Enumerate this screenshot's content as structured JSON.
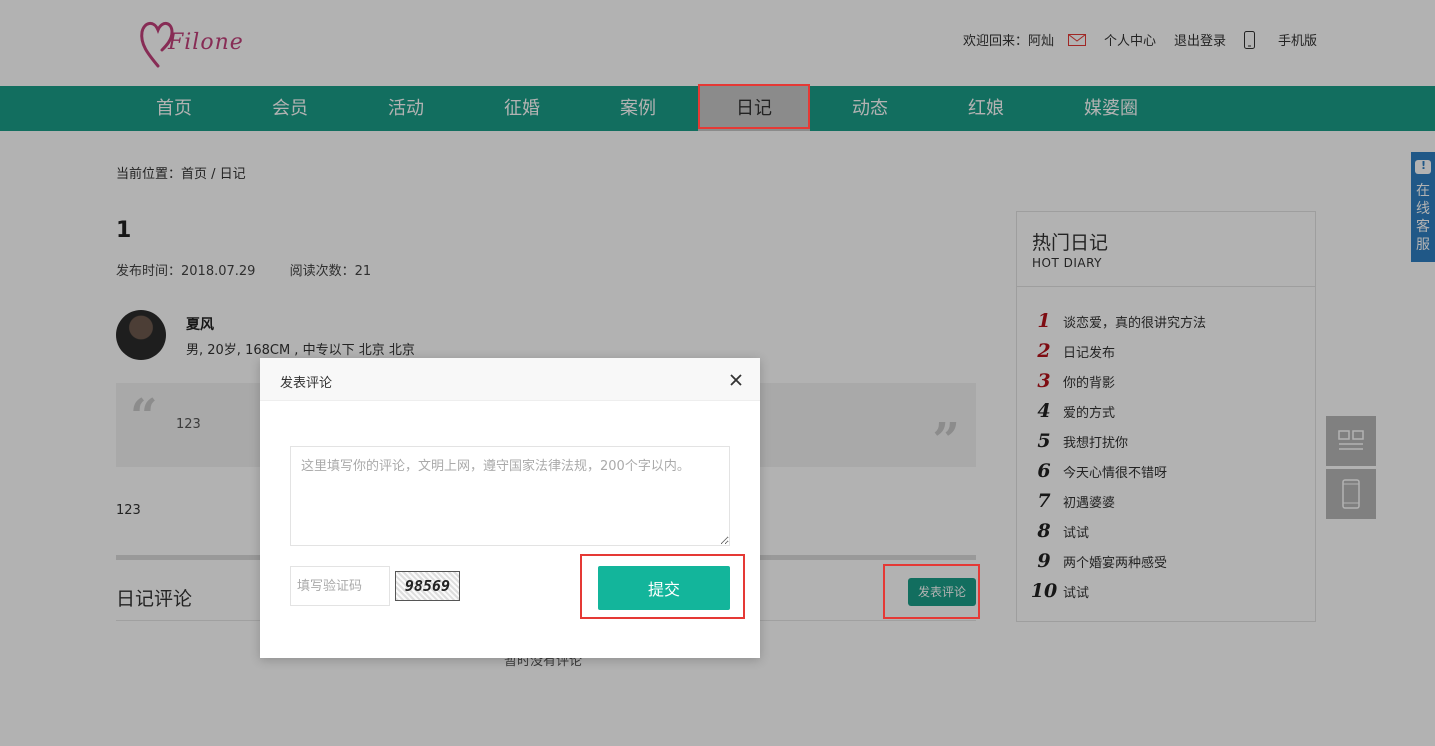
{
  "header": {
    "logo_text": "Filone",
    "welcome": "欢迎回来：阿灿",
    "links": {
      "profile": "个人中心",
      "logout": "退出登录",
      "mobile": "手机版"
    }
  },
  "nav": {
    "items": [
      "首页",
      "会员",
      "活动",
      "征婚",
      "案例",
      "日记",
      "动态",
      "红娘",
      "媒婆圈"
    ],
    "active_index": 5
  },
  "breadcrumb": "当前位置：首页 / 日记",
  "article": {
    "title": "1",
    "publish_time": "发布时间：2018.07.29",
    "read_count": "阅读次数：21",
    "author": {
      "name": "夏风",
      "info": "男, 20岁, 168CM , 中专以下 北京 北京"
    },
    "quote": "123",
    "content": "123"
  },
  "comments": {
    "title": "日记评论",
    "post_button": "发表评论",
    "empty_text": "暂时没有评论"
  },
  "sidebar": {
    "title": "热门日记",
    "subtitle": "HOT DIARY",
    "items": [
      {
        "num": "1",
        "title": "谈恋爱，真的很讲究方法"
      },
      {
        "num": "2",
        "title": "日记发布"
      },
      {
        "num": "3",
        "title": "你的背影"
      },
      {
        "num": "4",
        "title": "爱的方式"
      },
      {
        "num": "5",
        "title": "我想打扰你"
      },
      {
        "num": "6",
        "title": "今天心情很不错呀"
      },
      {
        "num": "7",
        "title": "初遇婆婆"
      },
      {
        "num": "8",
        "title": "试试"
      },
      {
        "num": "9",
        "title": "两个婚宴两种感受"
      },
      {
        "num": "10",
        "title": "试试"
      }
    ]
  },
  "service": {
    "label": "在线客服"
  },
  "modal": {
    "title": "发表评论",
    "textarea_placeholder": "这里填写你的评论，文明上网，遵守国家法律法规，200个字以内。",
    "captcha_placeholder": "填写验证码",
    "captcha_code": "98569",
    "submit": "提交"
  },
  "colors": {
    "nav": "#1a9e88",
    "submit": "#13b59b",
    "highlight": "#e53935",
    "service": "#2e7fc2",
    "rank_red": "#b5121b"
  }
}
